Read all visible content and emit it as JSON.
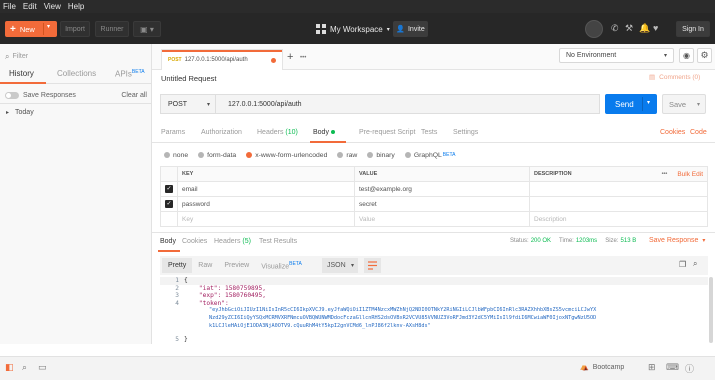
{
  "menubar": [
    "File",
    "Edit",
    "View",
    "Help"
  ],
  "header": {
    "new_label": "New",
    "import_label": "Import",
    "runner_label": "Runner",
    "workspace_label": "My Workspace",
    "invite_label": "Invite",
    "signin_label": "Sign In"
  },
  "sidebar": {
    "filter_placeholder": "Filter",
    "tabs": {
      "history": "History",
      "collections": "Collections",
      "apis": "APIs",
      "beta": "BETA"
    },
    "save_responses": "Save Responses",
    "clear_all": "Clear all",
    "group": "Today"
  },
  "tabbar": {
    "method": "POST",
    "url": "127.0.0.1:5000/api/auth",
    "plus": "+",
    "more": "•••"
  },
  "env": {
    "label": "No Environment"
  },
  "request": {
    "title": "Untitled Request",
    "comments": "Comments (0)",
    "method": "POST",
    "url": "127.0.0.1:5000/api/auth",
    "send": "Send",
    "save": "Save"
  },
  "req_tabs": [
    "Params",
    "Authorization",
    "Headers",
    "Body",
    "Pre-request Script",
    "Tests",
    "Settings"
  ],
  "headers_count": "(10)",
  "cookies_link": "Cookies",
  "code_link": "Code",
  "body_types": [
    "none",
    "form-data",
    "x-www-form-urlencoded",
    "raw",
    "binary",
    "GraphQL"
  ],
  "graphql_beta": "BETA",
  "kv_table": {
    "headers": {
      "key": "KEY",
      "value": "VALUE",
      "description": "DESCRIPTION",
      "more": "•••",
      "bulk": "Bulk Edit"
    },
    "rows": [
      {
        "key": "email",
        "value": "test@example.org"
      },
      {
        "key": "password",
        "value": "secret"
      }
    ],
    "placeholders": {
      "key": "Key",
      "value": "Value",
      "description": "Description"
    }
  },
  "response": {
    "tabs": [
      "Body",
      "Cookies",
      "Headers",
      "Test Results"
    ],
    "headers_count": "(5)",
    "status_label": "Status:",
    "status": "200 OK",
    "time_label": "Time:",
    "time": "1203ms",
    "size_label": "Size:",
    "size": "513 B",
    "save_response": "Save Response",
    "views": [
      "Pretty",
      "Raw",
      "Preview",
      "Visualize"
    ],
    "visualize_beta": "BETA",
    "format": "JSON"
  },
  "code_lines": [
    {
      "n": "1",
      "text": "{"
    },
    {
      "n": "2",
      "text": "    \"iat\": 1580759895,"
    },
    {
      "n": "3",
      "text": "    \"exp\": 1580760495,"
    },
    {
      "n": "4",
      "text": "    \"token\":"
    },
    {
      "n": "",
      "text": "        \"eyJhbGciOiJIUzI1NiIsInR5cCI6IkpXVCJ9.eyJfaWQiOiI1ZTM4NzcxMWZhNjQ2NDI0OTNkY2RiNGIiLCJlbWFpbCI6InRlc3RAZXhhbXBsZS5vcmciLCJwYX"
    },
    {
      "n": "",
      "text": "        Nzd29yZCI6IiQyYSQxMCRMVXRFNmcuOVBQWUNWMDdocFczaGllcnRHS2dsOVBxR2VCVU85VVNUZ3VoRFJmd3Y2dC5YMiIsIl9fdiI6MCwiaWF0IjoxNTgwNzU5OD"
    },
    {
      "n": "",
      "text": "        k1LCJleHAiOjE1ODA3NjA0OTV9.cQuuRhM4tY5kpI2gnVCMd6_lnPJ86f2lknv-AXsH8ds\""
    },
    {
      "n": "5",
      "text": "}"
    }
  ],
  "footer": {
    "bootcamp": "Bootcamp"
  },
  "colors": {
    "accent": "#f26b3a",
    "send_blue": "#097bed",
    "status_green": "#0cbb52"
  }
}
